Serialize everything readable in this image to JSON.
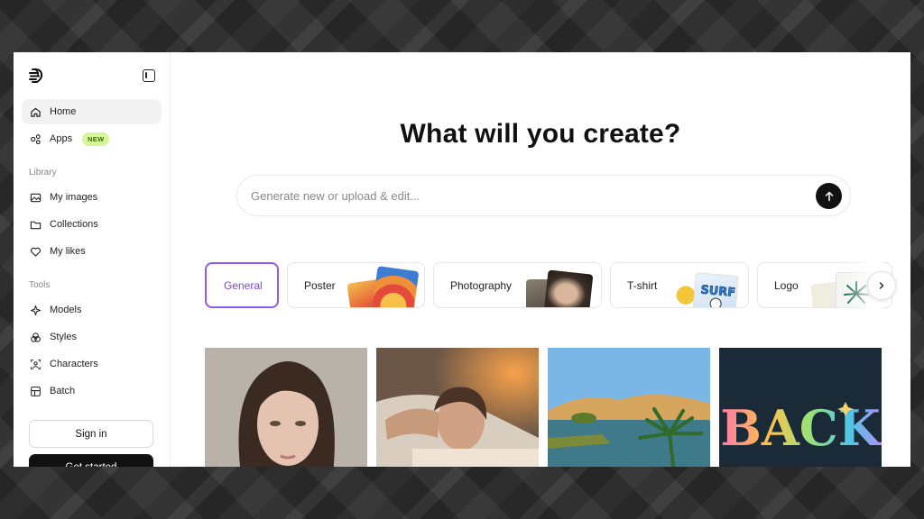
{
  "sidebar": {
    "logo": "brand-logo",
    "nav": [
      {
        "label": "Home",
        "icon": "home-icon",
        "active": true
      },
      {
        "label": "Apps",
        "icon": "apps-icon",
        "badge": "NEW"
      }
    ],
    "library": {
      "label": "Library",
      "items": [
        {
          "label": "My images",
          "icon": "images-icon"
        },
        {
          "label": "Collections",
          "icon": "folder-icon"
        },
        {
          "label": "My likes",
          "icon": "heart-icon"
        }
      ]
    },
    "tools": {
      "label": "Tools",
      "items": [
        {
          "label": "Models",
          "icon": "sparkle-icon"
        },
        {
          "label": "Styles",
          "icon": "styles-icon"
        },
        {
          "label": "Characters",
          "icon": "characters-icon"
        },
        {
          "label": "Batch",
          "icon": "batch-icon"
        }
      ]
    },
    "signin_label": "Sign in",
    "getstarted_label": "Get started"
  },
  "main": {
    "title": "What will you create?",
    "search_placeholder": "Generate new or upload & edit...",
    "categories": [
      {
        "label": "General",
        "selected": true
      },
      {
        "label": "Poster"
      },
      {
        "label": "Photography"
      },
      {
        "label": "T-shirt"
      },
      {
        "label": "Logo"
      }
    ],
    "gallery_back_text": "BACK"
  },
  "colors": {
    "accent": "#8c5cf0",
    "badge_bg": "#d7f59a",
    "dark": "#111111"
  }
}
